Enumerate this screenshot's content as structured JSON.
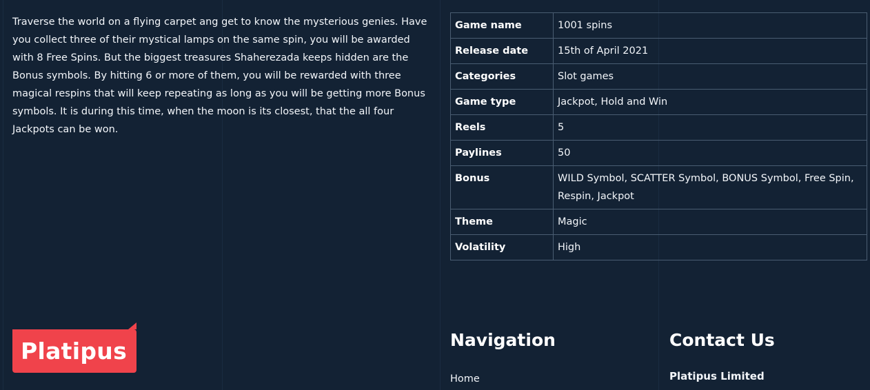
{
  "description": "Traverse the world on a flying carpet ang get to know the mysterious genies. Have you collect three of their mystical lamps on the same spin, you will be awarded with 8 Free Spins. But the biggest treasures Shaherezada keeps hidden are the Bonus symbols. By hitting 6 or more of them, you will be rewarded with three magical respins that will keep repeating as long as you will be getting more Bonus symbols. It is during this time, when the moon is its closest, that the all four Jackpots can be won.",
  "info_table": [
    {
      "key": "Game name",
      "value": "1001 spins"
    },
    {
      "key": "Release date",
      "value": "15th of April 2021"
    },
    {
      "key": "Categories",
      "value": "Slot games"
    },
    {
      "key": "Game type",
      "value": "Jackpot, Hold and Win"
    },
    {
      "key": "Reels",
      "value": "5"
    },
    {
      "key": "Paylines",
      "value": "50"
    },
    {
      "key": "Bonus",
      "value": "WILD Symbol, SCATTER Symbol, BONUS Symbol, Free Spin, Respin, Jackpot"
    },
    {
      "key": "Theme",
      "value": "Magic"
    },
    {
      "key": "Volatility",
      "value": "High"
    }
  ],
  "footer": {
    "logo_text": "Platipus",
    "navigation_heading": "Navigation",
    "navigation_links": [
      "Home"
    ],
    "contact_heading": "Contact Us",
    "company_name": "Platipus Limited"
  },
  "colors": {
    "background": "#132234",
    "logo_background": "#f0434b",
    "table_border": "#4a5d72"
  }
}
